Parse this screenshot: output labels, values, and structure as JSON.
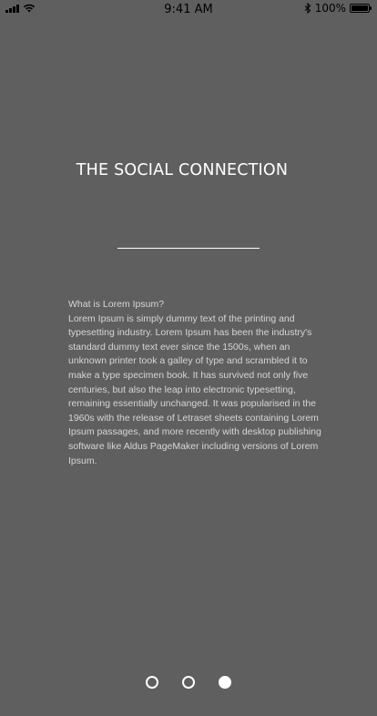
{
  "status_bar": {
    "time": "9:41 AM",
    "battery_text": "100%",
    "icons": [
      "signal-icon",
      "wifi-icon",
      "bluetooth-icon",
      "battery-icon"
    ]
  },
  "screen": {
    "title": "THE SOCIAL CONNECTION",
    "heading": "What is Lorem Ipsum?",
    "body": "Lorem Ipsum is simply dummy text of the printing and typesetting industry. Lorem Ipsum has been the industry's standard dummy text ever since the 1500s, when an unknown printer took a galley of type and scrambled it to make a type specimen book. It has survived not only five centuries, but also the leap into electronic typesetting, remaining essentially unchanged. It was popularised in the 1960s with the release of Letraset sheets containing Lorem Ipsum passages, and more recently with desktop publishing software like Aldus PageMaker including versions of Lorem Ipsum."
  },
  "pager": {
    "total": 3,
    "active_index": 3
  },
  "colors": {
    "background": "#5f5f5f",
    "text": "#ffffff",
    "body_text": "#d6d6d6"
  }
}
